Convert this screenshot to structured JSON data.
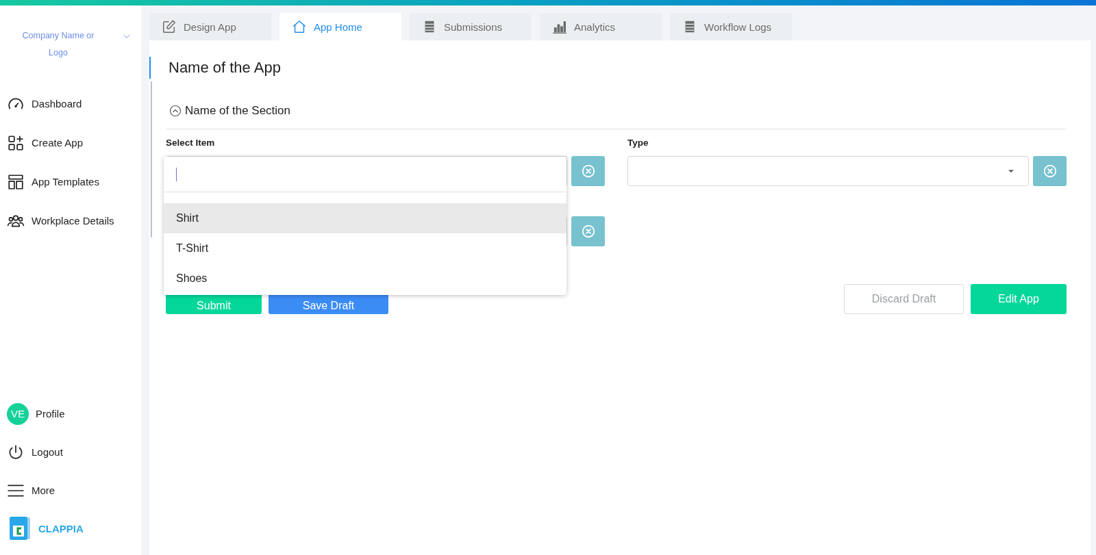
{
  "sidebar": {
    "company": "Company Name or Logo",
    "nav": [
      {
        "label": "Dashboard"
      },
      {
        "label": "Create App"
      },
      {
        "label": "App Templates"
      },
      {
        "label": "Workplace Details"
      }
    ],
    "bottom": [
      {
        "label": "Profile",
        "kind": "avatar",
        "initials": "VE"
      },
      {
        "label": "Logout",
        "kind": "power"
      },
      {
        "label": "More",
        "kind": "menu"
      }
    ],
    "brand": "CLAPPIA"
  },
  "tabs": [
    {
      "label": "Design App",
      "selected": false
    },
    {
      "label": "App Home",
      "selected": true
    },
    {
      "label": "Submissions",
      "selected": false
    },
    {
      "label": "Analytics",
      "selected": false
    },
    {
      "label": "Workflow Logs",
      "selected": false
    }
  ],
  "app_title": "Name of the App",
  "section": {
    "title": "Name of the Section",
    "expanded": true
  },
  "fields": [
    {
      "label": "Select Item",
      "kind": "search"
    },
    {
      "label": "Type",
      "kind": "select"
    }
  ],
  "dropdown": {
    "options": [
      {
        "label": "Shirt",
        "highlighted": true
      },
      {
        "label": "T-Shirt",
        "highlighted": false
      },
      {
        "label": "Shoes",
        "highlighted": false
      }
    ]
  },
  "buttons_left": [
    {
      "label": "Submit",
      "kind": "success"
    },
    {
      "label": "Save Draft",
      "kind": "primary"
    }
  ],
  "buttons_right": [
    {
      "label": "Discard Draft",
      "kind": "outline"
    },
    {
      "label": "Edit App",
      "kind": "success"
    }
  ]
}
